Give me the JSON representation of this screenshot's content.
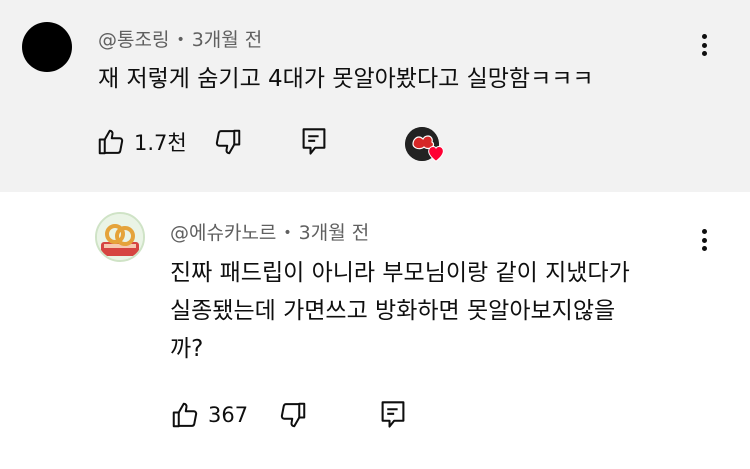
{
  "comment": {
    "author": "@통조링",
    "time": "3개월 전",
    "text": "재 저렇게 숨기고 4대가 못알아봤다고 실망함ㅋㅋㅋ",
    "likes": "1.7천",
    "heart_color": "#ff0033",
    "avatar_color": "#000000"
  },
  "reply": {
    "author": "@에슈카노르",
    "time": "3개월 전",
    "lines": [
      "진짜 패드립이 아니라 부모님이랑 같이 지냈다가",
      "실종됐는데 가면쓰고 방화하면 못알아보지않을",
      "까?"
    ],
    "likes": "367"
  },
  "separator": "•",
  "icons": [
    "thumbs-up-icon",
    "thumbs-down-icon",
    "reply-icon",
    "more-vert-icon",
    "heart-icon"
  ]
}
